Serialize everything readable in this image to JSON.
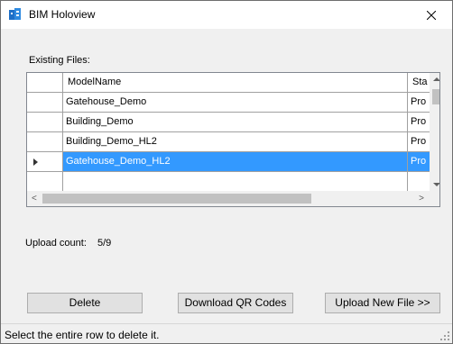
{
  "window": {
    "title": "BIM Holoview",
    "close_glyph": "✕",
    "icon": "bim-logo-icon"
  },
  "files": {
    "label": "Existing Files:",
    "columns": [
      "ModelName",
      "Sta"
    ],
    "rows": [
      {
        "model": "Gatehouse_Demo",
        "status": "Pro"
      },
      {
        "model": "Building_Demo",
        "status": "Pro"
      },
      {
        "model": "Building_Demo_HL2",
        "status": "Pro"
      },
      {
        "model": "Gatehouse_Demo_HL2",
        "status": "Pro",
        "selected": true
      }
    ],
    "selection_color": "#3399ff"
  },
  "upload": {
    "label": "Upload count:",
    "value": "5/9"
  },
  "buttons": {
    "delete": "Delete",
    "qr": "Download QR Codes",
    "upload": "Upload New File >>"
  },
  "status": {
    "text": "Select the entire row to delete it."
  }
}
